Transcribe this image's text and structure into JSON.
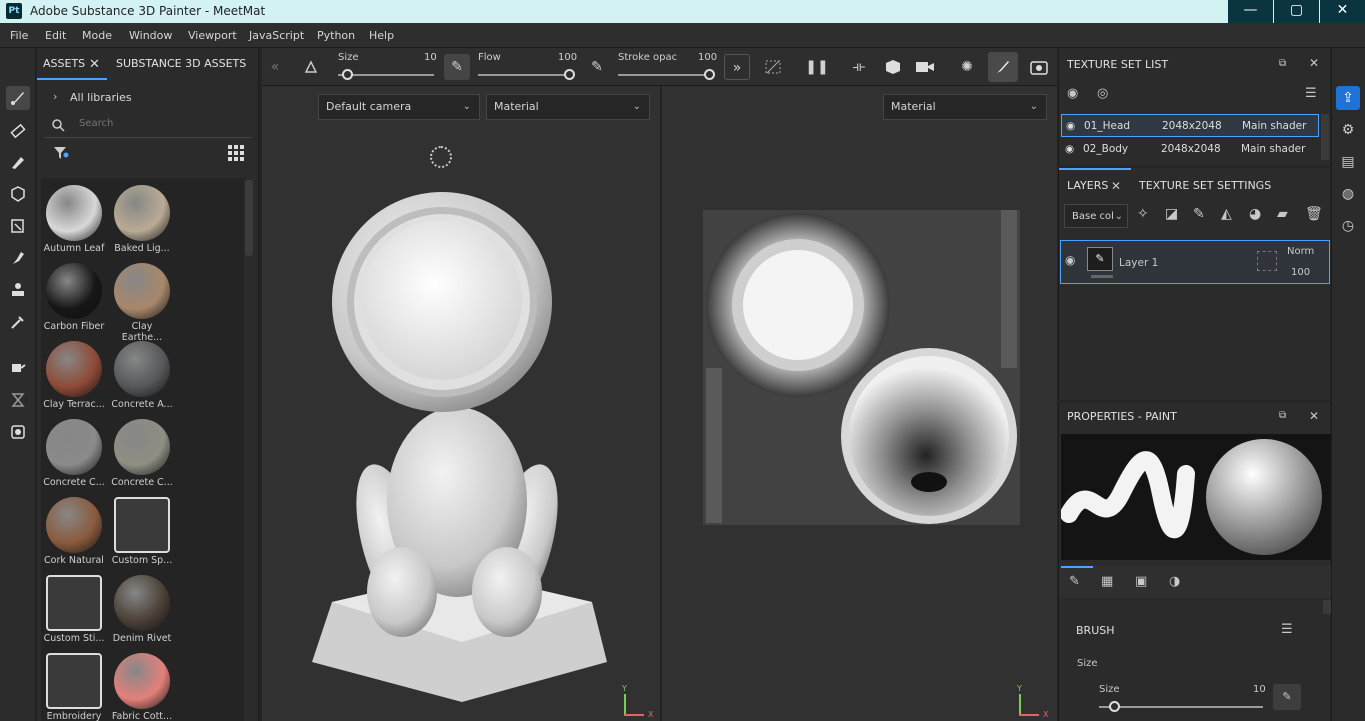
{
  "window": {
    "app_icon_text": "Pt",
    "title": "Adobe Substance 3D Painter - MeetMat",
    "controls": [
      "—",
      "▢",
      "✕"
    ]
  },
  "menu": [
    "File",
    "Edit",
    "Mode",
    "Window",
    "Viewport",
    "JavaScript",
    "Python",
    "Help"
  ],
  "left_tools": [
    "paint-brush-icon",
    "eraser-icon",
    "projection-icon",
    "geometry-mask-icon",
    "polygon-fill-icon",
    "smudge-icon",
    "clone-icon",
    "color-picker-icon",
    "material-picker-icon",
    "bake-icon",
    "layer-icon"
  ],
  "assets_panel": {
    "tabs": [
      "ASSETS",
      "SUBSTANCE 3D ASSETS"
    ],
    "breadcrumb": "All libraries",
    "search_placeholder": "Search",
    "items": [
      {
        "name": "Autumn Leaf",
        "color": "#d8d8d8"
      },
      {
        "name": "Baked Lig...",
        "color": "#b9ab94"
      },
      {
        "name": "Carbon Fiber",
        "color": "#161616"
      },
      {
        "name": "Clay Earthe...",
        "color": "#a8876a"
      },
      {
        "name": "Clay Terrac...",
        "color": "#8e4a36"
      },
      {
        "name": "Concrete A...",
        "color": "#55575a"
      },
      {
        "name": "Concrete C...",
        "color": "#8a8a8a"
      },
      {
        "name": "Concrete C...",
        "color": "#8f8e82"
      },
      {
        "name": "Cork Natural",
        "color": "#8a5a3c"
      },
      {
        "name": "Custom Sp...",
        "color": "#3a3a3a"
      },
      {
        "name": "Custom Sti...",
        "color": "#3a3a3a"
      },
      {
        "name": "Denim Rivet",
        "color": "#4a4036"
      },
      {
        "name": "Embroidery",
        "color": "#3a3a3a"
      },
      {
        "name": "Fabric Cott...",
        "color": "#e3807a"
      }
    ]
  },
  "viewport_toolbar": {
    "size_label": "Size",
    "size_value": "10",
    "size_fraction": 0.1,
    "flow_label": "Flow",
    "flow_value": "100",
    "flow_fraction": 1.0,
    "opacity_label": "Stroke opac",
    "opacity_value": "100",
    "opacity_fraction": 1.0
  },
  "viewport_3d": {
    "camera": "Default camera",
    "mode": "Material",
    "axis_y": "Y",
    "axis_x": "X"
  },
  "viewport_2d": {
    "mode": "Material",
    "axis_y": "Y",
    "axis_x": "X"
  },
  "texture_set_list": {
    "title": "TEXTURE SET LIST",
    "rows": [
      {
        "name": "01_Head",
        "res": "2048x2048",
        "shader": "Main shader"
      },
      {
        "name": "02_Body",
        "res": "2048x2048",
        "shader": "Main shader"
      }
    ]
  },
  "layers": {
    "tabs": [
      "LAYERS",
      "TEXTURE SET SETTINGS"
    ],
    "channel": "Base col",
    "layer_name": "Layer 1",
    "blend": "Norm",
    "opacity": "100"
  },
  "properties": {
    "title": "PROPERTIES - PAINT",
    "section": "BRUSH",
    "size_group": "Size",
    "size_label": "Size",
    "size_value": "10",
    "size_fraction": 0.1
  },
  "colors": {
    "accent": "#4aa3ff",
    "titlebar": "#d2f2f4",
    "panel": "#2b2b2b",
    "viewport": "#313131"
  }
}
